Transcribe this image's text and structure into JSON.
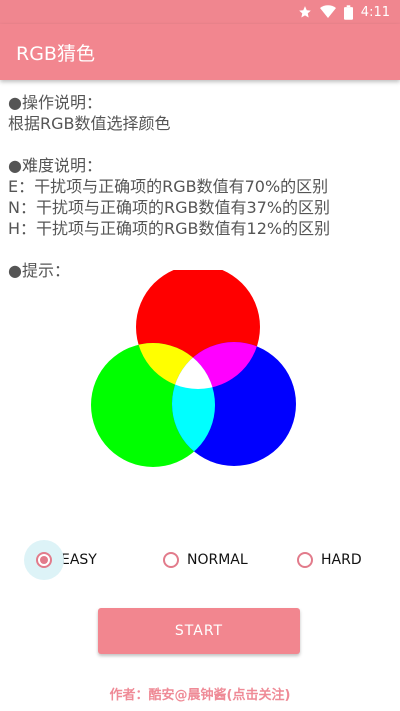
{
  "status_bar": {
    "time": "4:11",
    "icons": [
      "star-icon",
      "wifi-icon",
      "battery-icon"
    ]
  },
  "app_bar": {
    "title": "RGB猜色"
  },
  "instructions": {
    "ops_title": "●操作说明：",
    "ops_text": "根据RGB数值选择颜色",
    "diff_title": "●难度说明：",
    "diff_e": "E：干扰项与正确项的RGB数值有70%的区别",
    "diff_n": "N：干扰项与正确项的RGB数值有37%的区别",
    "diff_h": "H：干扰项与正确项的RGB数值有12%的区别",
    "hint_title": "●提示："
  },
  "difficulty": {
    "options": [
      "EASY",
      "NORMAL",
      "HARD"
    ],
    "selected": "EASY"
  },
  "start_label": "START",
  "author": "作者：酷安@晨钟酱(点击关注)",
  "colors": {
    "accent": "#f2868f",
    "red": "#ff0000",
    "green": "#00ff00",
    "blue": "#0000ff",
    "yellow": "#ffff00",
    "magenta": "#ff00ff",
    "cyan": "#00ffff",
    "white": "#ffffff"
  }
}
